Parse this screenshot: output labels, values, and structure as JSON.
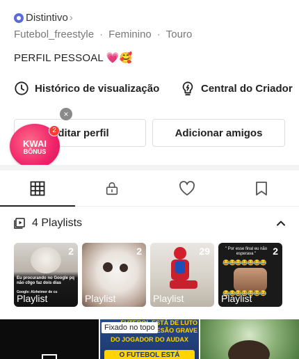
{
  "profile": {
    "badge_label": "Distintivo",
    "badge_chevron": "›",
    "meta": [
      "Futebol_freestyle",
      "Feminino",
      "Touro"
    ],
    "meta_separator": "·",
    "bio": "PERFIL PESSOAL 💗🥰"
  },
  "shortcuts": [
    {
      "label": "Histórico de visualização",
      "icon": "clock-icon"
    },
    {
      "label": "Central do Criador",
      "icon": "bulb-icon"
    }
  ],
  "buttons": {
    "edit_profile": "Editar perfil",
    "add_friends": "Adicionar amigos"
  },
  "promo": {
    "line1": "KWAI",
    "line2": "BÔNUS",
    "count": "2",
    "close": "×"
  },
  "tabs": [
    {
      "name": "grid",
      "icon": "grid-icon",
      "active": true
    },
    {
      "name": "private",
      "icon": "lock-icon",
      "active": false
    },
    {
      "name": "likes",
      "icon": "heart-icon",
      "active": false
    },
    {
      "name": "saved",
      "icon": "bookmark-icon",
      "active": false
    }
  ],
  "playlists": {
    "header": "4 Playlists",
    "items": [
      {
        "count": "2",
        "label": "Playlist",
        "caption": "Eu procurando no Google pq não c0go faz dois dias",
        "caption2": "Google: Alzheimer de cu"
      },
      {
        "count": "2",
        "label": "Playlist"
      },
      {
        "count": "29",
        "label": "Playlist"
      },
      {
        "count": "2",
        "label": "Playlist",
        "caption": "\" Por esse final eu não esperava \""
      }
    ]
  },
  "feed": {
    "pinned": "Fixado no topo",
    "headline": "FUTEBOL ESTÁ DE LUTO",
    "headline2": "LESÃO GRAVE",
    "headline3": "DO JOGADOR DO AUDAX",
    "headline4": "O FUTEBOL ESTÁ"
  }
}
